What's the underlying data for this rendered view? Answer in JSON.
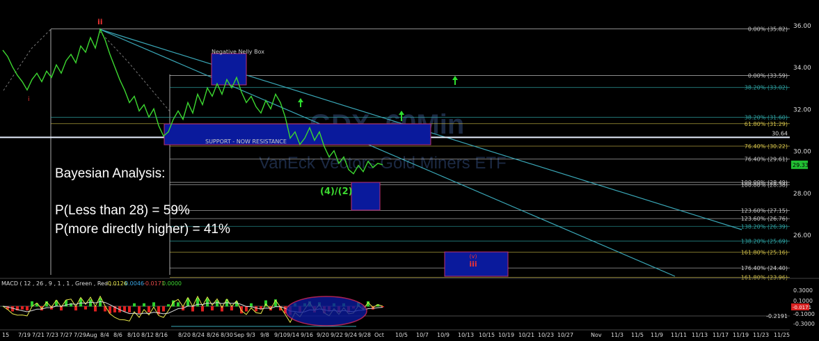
{
  "chart_data": {
    "type": "line",
    "title": "",
    "watermark": "GDX, 60Min — VanEck Vectors Gold Miners ETF",
    "y_axis": {
      "ticks": [
        "36.00",
        "34.00",
        "32.00",
        "30.00",
        "28.00",
        "26.00"
      ],
      "values": [
        36,
        34,
        32,
        30,
        28,
        26
      ],
      "ylim": [
        23.6,
        36.8
      ]
    },
    "x_axis": {
      "ticks": [
        "15",
        "7/19",
        "7/21",
        "7/23",
        "7/27",
        "7/29",
        "Aug",
        "8/4",
        "8/6",
        "8/10",
        "8/12",
        "8/16",
        "8/20",
        "8/24",
        "8/26",
        "8/30",
        "Sep",
        "9/3",
        "9/8",
        "9/10",
        "9/14",
        "9/16",
        "9/20",
        "9/22",
        "9/24",
        "9/28",
        "Oct",
        "10/5",
        "10/7",
        "10/9",
        "10/13",
        "10/15",
        "10/19",
        "10/21",
        "10/23",
        "10/27",
        "Nov",
        "11/3",
        "11/5",
        "11/9",
        "11/11",
        "11/13",
        "11/17",
        "11/19",
        "11/23",
        "11/25"
      ]
    },
    "series": [
      {
        "values": [
          34.8,
          34.5,
          34.0,
          33.6,
          33.3,
          32.9,
          33.4,
          33.7,
          33.3,
          33.8,
          33.5,
          34.1,
          33.7,
          34.3,
          34.6,
          34.2,
          35.0,
          34.7,
          35.4,
          34.9,
          35.8,
          35.3,
          34.6,
          34.0,
          33.4,
          32.9,
          32.3,
          32.6,
          31.9,
          32.2,
          31.6,
          32.0,
          31.2,
          30.7,
          30.9,
          31.5,
          31.9,
          31.5,
          32.3,
          31.8,
          32.7,
          32.2,
          33.0,
          32.6,
          33.2,
          32.7,
          33.4,
          33.0,
          33.5,
          32.8,
          32.3,
          32.6,
          32.1,
          31.8,
          32.4,
          32.0,
          32.7,
          32.3,
          31.6,
          30.6,
          30.9,
          30.3,
          30.6,
          31.1,
          30.5,
          30.9,
          30.2,
          29.7,
          30.0,
          29.4,
          29.7,
          29.1,
          28.9,
          29.3,
          29.0,
          29.5,
          29.2,
          29.4,
          29.33
        ]
      }
    ],
    "last_price_label": "29.33",
    "price_line_label": "30.64",
    "fib_levels": [
      {
        "label": "0.00% (35.82)",
        "value": 35.82,
        "color": "#c8c8c8"
      },
      {
        "label": "0.00% (33.59)",
        "value": 33.59,
        "color": "#c8c8c8"
      },
      {
        "label": "38.20% (33.02)",
        "value": 33.02,
        "color": "#2fa7a7"
      },
      {
        "label": "38.20% (31.60)",
        "value": 31.6,
        "color": "#2fa7a7"
      },
      {
        "label": "61.80% (31.29)",
        "value": 31.29,
        "color": "#d4c24a"
      },
      {
        "label": "76.40% (30.22)",
        "value": 30.22,
        "color": "#d4c24a"
      },
      {
        "label": "76.40% (29.61)",
        "value": 29.61,
        "color": "#c8c8c8"
      },
      {
        "label": "100.00% (28.49)",
        "value": 28.49,
        "color": "#c8c8c8"
      },
      {
        "label": "100.00% (28.38)",
        "value": 28.38,
        "color": "#c8c8c8"
      },
      {
        "label": "123.60% (27.15)",
        "value": 27.15,
        "color": "#c8c8c8"
      },
      {
        "label": "123.60% (26.76)",
        "value": 26.76,
        "color": "#c8c8c8"
      },
      {
        "label": "138.20% (26.39)",
        "value": 26.39,
        "color": "#2fa7a7"
      },
      {
        "label": "138.20% (25.69)",
        "value": 25.69,
        "color": "#2fa7a7"
      },
      {
        "label": "161.80% (25.16)",
        "value": 25.16,
        "color": "#d4c24a"
      },
      {
        "label": "176.40% (24.40)",
        "value": 24.4,
        "color": "#c8c8c8"
      },
      {
        "label": "161.80% (23.96)",
        "value": 23.96,
        "color": "#d4c24a"
      }
    ],
    "boxes": [
      {
        "label": "Negative Nelly Box"
      },
      {
        "label": "SUPPORT - NOW RESISTANCE"
      }
    ],
    "wave_labels": {
      "main": "(4)/(2)",
      "top": "ii",
      "left": "i",
      "right_box": "(v)",
      "right_box2": "iii"
    },
    "indicator": {
      "label": "MACD ( 12 , 26 , 9 , 1 , 1 , Green , Red , ...",
      "values": [
        "-0.0126",
        "0.0046",
        "-0.0171",
        "0.0000"
      ],
      "axis": [
        "0.3000",
        "0.1000",
        "-0.1000",
        "-0.3000"
      ],
      "level_label": "-0.2191",
      "right_label": "-0.0171"
    }
  },
  "annotations": {
    "title": "Bayesian Analysis:",
    "line1": "P(Less than 28) = 59%",
    "line2": "P(more directly higher) = 41%"
  }
}
